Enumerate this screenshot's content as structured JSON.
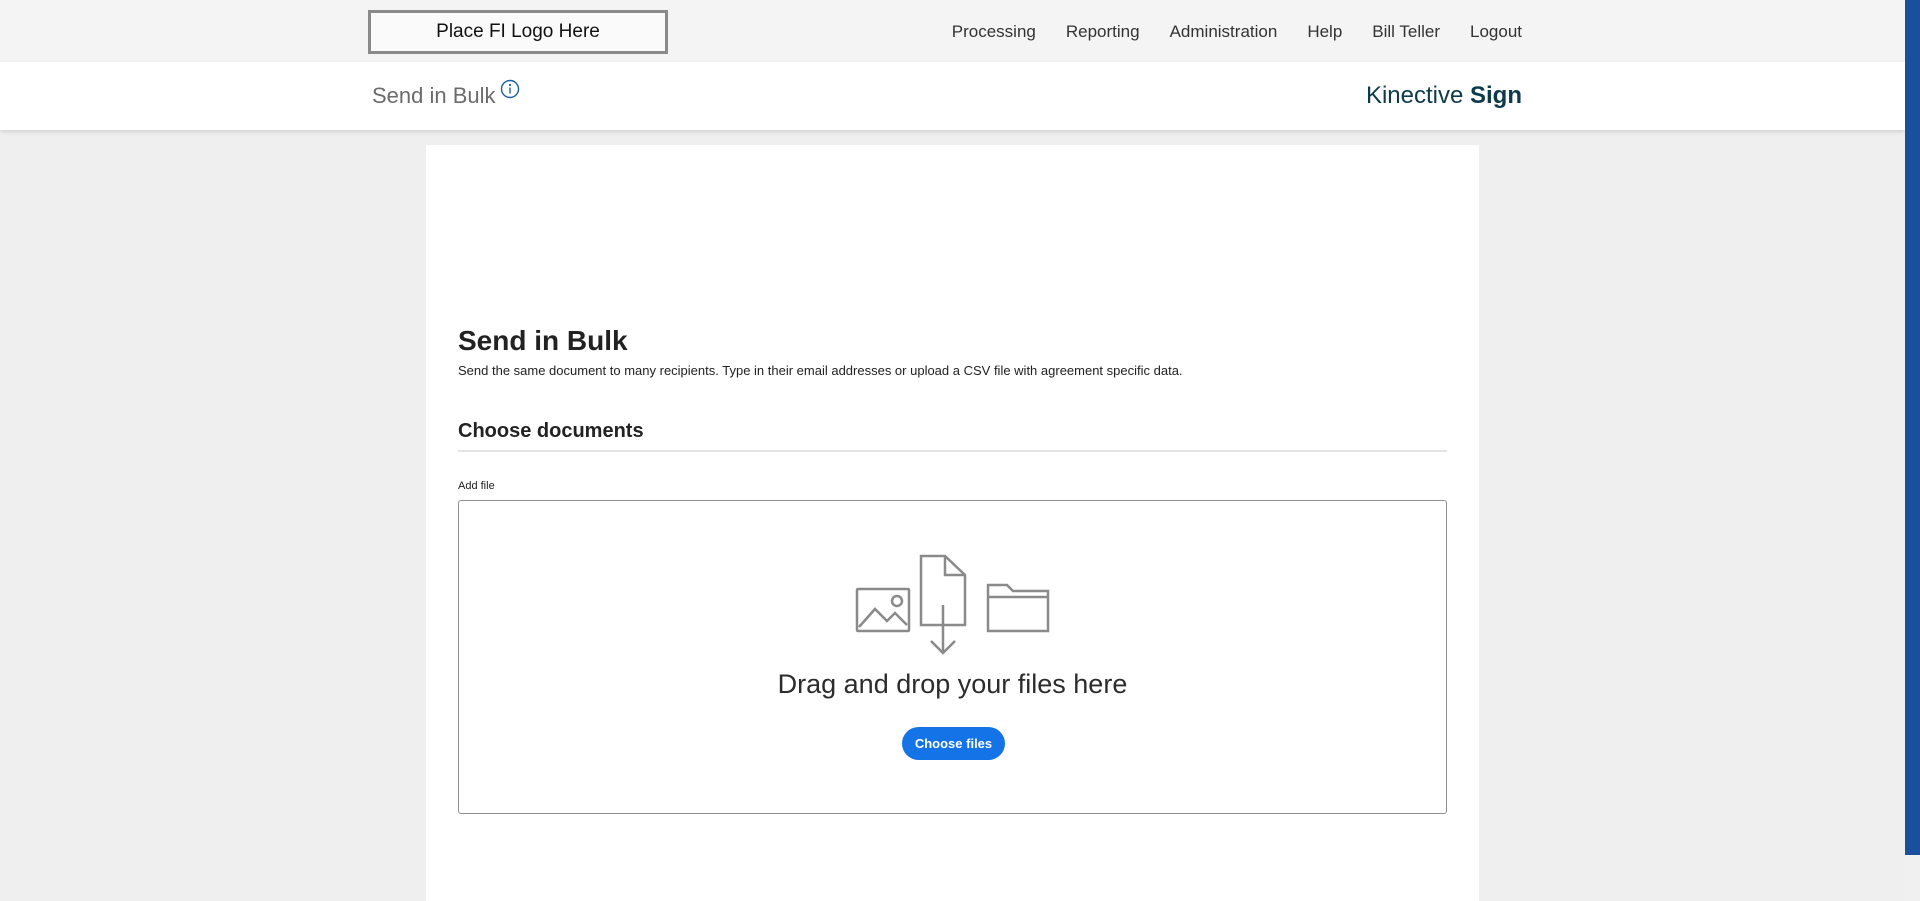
{
  "topbar": {
    "logo_text": "Place FI Logo Here",
    "nav": [
      "Processing",
      "Reporting",
      "Administration",
      "Help",
      "Bill Teller",
      "Logout"
    ]
  },
  "subheader": {
    "title": "Send in Bulk",
    "info_icon": "info-icon",
    "brand_light": "Kinective ",
    "brand_bold": "Sign"
  },
  "main": {
    "heading": "Send in Bulk",
    "description": "Send the same document to many recipients. Type in their email addresses or upload a CSV file with agreement specific data.",
    "section_title": "Choose documents",
    "add_file_label": "Add file",
    "dropzone": {
      "text": "Drag and drop your files here",
      "button_label": "Choose files",
      "icons": [
        "image-icon",
        "document-download-icon",
        "folder-icon"
      ]
    }
  },
  "colors": {
    "accent": "#1473e6",
    "brand": "#0d3b4a",
    "scrollbar": "#1a4f9c"
  }
}
